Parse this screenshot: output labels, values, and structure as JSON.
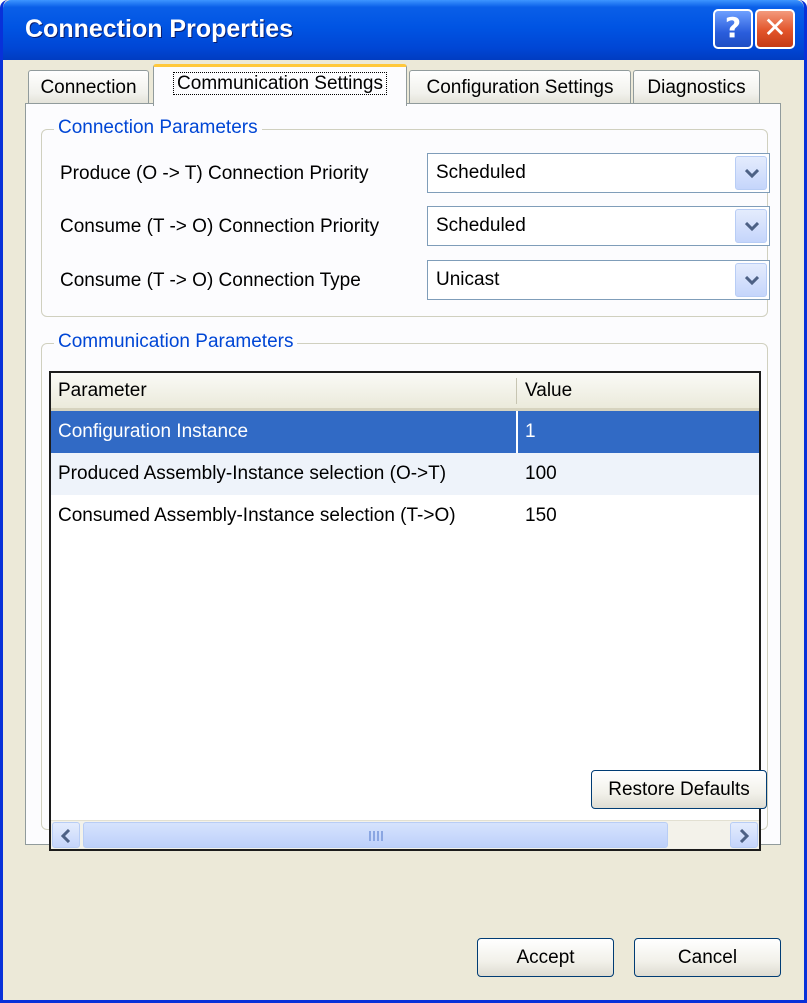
{
  "window": {
    "title": "Connection Properties",
    "help_glyph": "?",
    "close_glyph": "✕"
  },
  "tabs": [
    {
      "label": "Connection",
      "active": false
    },
    {
      "label": "Communication Settings",
      "active": true
    },
    {
      "label": "Configuration Settings",
      "active": false
    },
    {
      "label": "Diagnostics",
      "active": false
    }
  ],
  "connection_parameters": {
    "group_label": "Connection Parameters",
    "fields": [
      {
        "label": "Produce (O -> T) Connection Priority",
        "value": "Scheduled"
      },
      {
        "label": "Consume (T -> O) Connection Priority",
        "value": "Scheduled"
      },
      {
        "label": "Consume (T -> O) Connection Type",
        "value": "Unicast"
      }
    ]
  },
  "communication_parameters": {
    "group_label": "Communication Parameters",
    "columns": [
      "Parameter",
      "Value"
    ],
    "rows": [
      {
        "parameter": "Configuration Instance",
        "value": "1",
        "selected": true
      },
      {
        "parameter": "Produced Assembly-Instance selection (O->T)",
        "value": "100",
        "selected": false
      },
      {
        "parameter": "Consumed Assembly-Instance selection (T->O)",
        "value": "150",
        "selected": false
      }
    ],
    "restore_label": "Restore Defaults"
  },
  "footer": {
    "accept_label": "Accept",
    "cancel_label": "Cancel"
  },
  "colors": {
    "title_bar": "#0054e3",
    "selection": "#316ac5",
    "group_label": "#0046d5",
    "close_button": "#e2542a",
    "active_tab_highlight": "#ffc83c"
  }
}
